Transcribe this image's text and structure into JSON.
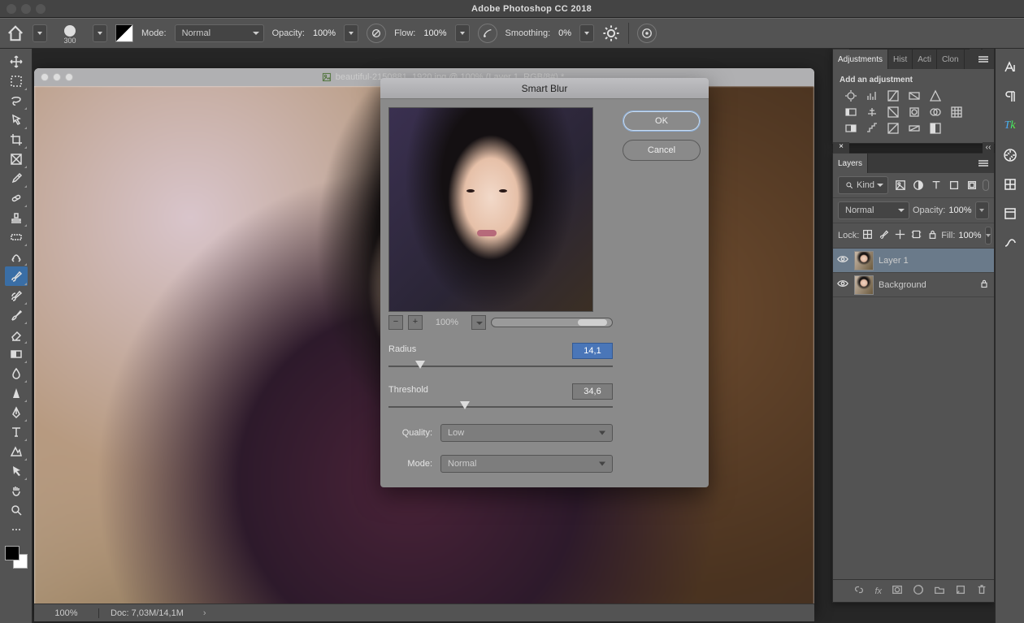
{
  "app": {
    "title": "Adobe Photoshop CC 2018"
  },
  "options": {
    "mode_label": "Mode:",
    "mode_value": "Normal",
    "opacity_label": "Opacity:",
    "opacity_value": "100%",
    "flow_label": "Flow:",
    "flow_value": "100%",
    "smoothing_label": "Smoothing:",
    "smoothing_value": "0%",
    "brush_size": "300"
  },
  "document": {
    "tab_title": "beautiful-2150881_1920.jpg @ 100% (Layer 1, RGB/8#) *",
    "zoom": "100%",
    "doc_info": "Doc: 7,03M/14,1M"
  },
  "dialog": {
    "title": "Smart Blur",
    "preview_zoom": "100%",
    "radius_label": "Radius",
    "radius_value": "14,1",
    "radius_pos_pct": 14,
    "threshold_label": "Threshold",
    "threshold_value": "34,6",
    "threshold_pos_pct": 34,
    "quality_label": "Quality:",
    "quality_value": "Low",
    "mode_label": "Mode:",
    "mode_value": "Normal",
    "ok": "OK",
    "cancel": "Cancel"
  },
  "adjustments": {
    "tab": "Adjustments",
    "tabs_other": [
      "Hist",
      "Acti",
      "Clon"
    ],
    "add_text": "Add an adjustment"
  },
  "layers": {
    "tab": "Layers",
    "kind_label": "Kind",
    "blend_mode": "Normal",
    "opacity_label": "Opacity:",
    "opacity_value": "100%",
    "lock_label": "Lock:",
    "fill_label": "Fill:",
    "fill_value": "100%",
    "items": [
      {
        "name": "Layer 1",
        "active": true,
        "locked": false
      },
      {
        "name": "Background",
        "active": false,
        "locked": true
      }
    ]
  }
}
